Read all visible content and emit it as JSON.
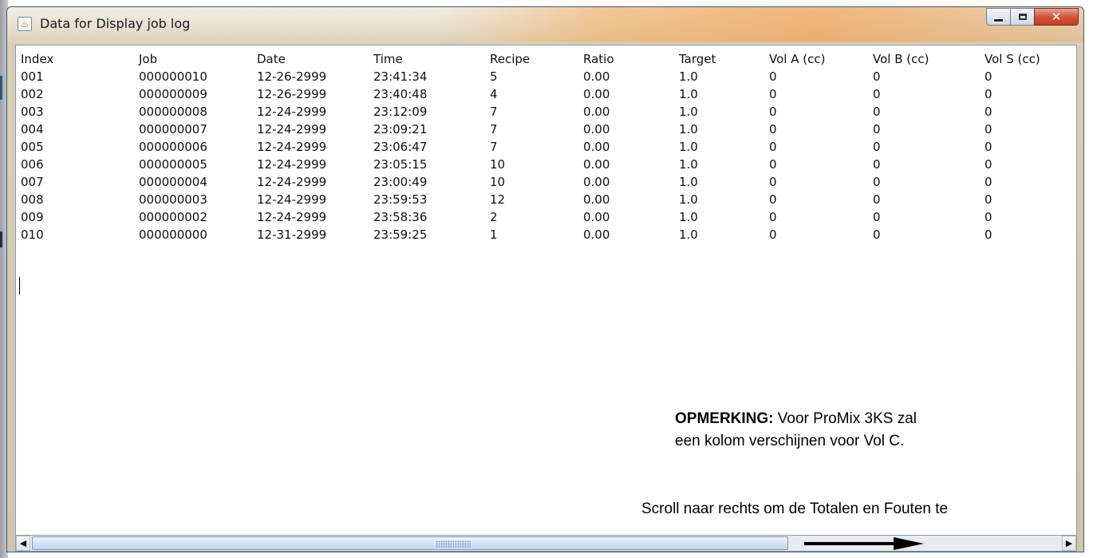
{
  "window": {
    "title": "Data for Display job log",
    "icon": "java-cup-icon",
    "controls": [
      "minimize",
      "maximize",
      "close"
    ]
  },
  "log": {
    "columns": [
      "Index",
      "Job",
      "Date",
      "Time",
      "Recipe",
      "Ratio",
      "Target",
      "Vol A (cc)",
      "Vol B (cc)",
      "Vol S (cc)"
    ],
    "rows": [
      [
        "001",
        "000000010",
        "12-26-2999",
        "23:41:34",
        "5",
        "0.00",
        "1.0",
        "0",
        "0",
        "0"
      ],
      [
        "002",
        "000000009",
        "12-26-2999",
        "23:40:48",
        "4",
        "0.00",
        "1.0",
        "0",
        "0",
        "0"
      ],
      [
        "003",
        "000000008",
        "12-24-2999",
        "23:12:09",
        "7",
        "0.00",
        "1.0",
        "0",
        "0",
        "0"
      ],
      [
        "004",
        "000000007",
        "12-24-2999",
        "23:09:21",
        "7",
        "0.00",
        "1.0",
        "0",
        "0",
        "0"
      ],
      [
        "005",
        "000000006",
        "12-24-2999",
        "23:06:47",
        "7",
        "0.00",
        "1.0",
        "0",
        "0",
        "0"
      ],
      [
        "006",
        "000000005",
        "12-24-2999",
        "23:05:15",
        "10",
        "0.00",
        "1.0",
        "0",
        "0",
        "0"
      ],
      [
        "007",
        "000000004",
        "12-24-2999",
        "23:00:49",
        "10",
        "0.00",
        "1.0",
        "0",
        "0",
        "0"
      ],
      [
        "008",
        "000000003",
        "12-24-2999",
        "23:59:53",
        "12",
        "0.00",
        "1.0",
        "0",
        "0",
        "0"
      ],
      [
        "009",
        "000000002",
        "12-24-2999",
        "23:58:36",
        "2",
        "0.00",
        "1.0",
        "0",
        "0",
        "0"
      ],
      [
        "010",
        "000000000",
        "12-31-2999",
        "23:59:25",
        "1",
        "0.00",
        "1.0",
        "0",
        "0",
        "0"
      ]
    ]
  },
  "annotation": {
    "note_label": "OPMERKING:",
    "note_line1": " Voor ProMix 3KS zal",
    "note_line2": "een kolom verschijnen voor Vol C.",
    "scroll_hint": "Scroll naar rechts om de Totalen en Fouten te"
  },
  "scrollbar": {
    "left_arrow": "◀",
    "right_arrow": "▶"
  }
}
